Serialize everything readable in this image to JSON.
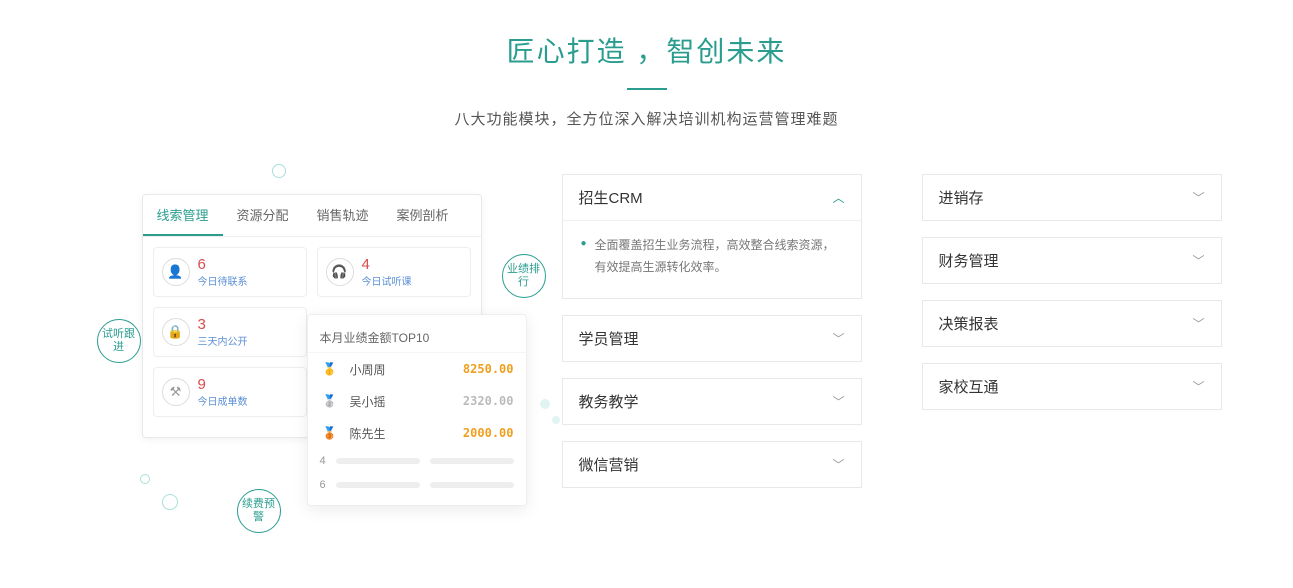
{
  "header": {
    "title": "匠心打造 ，智创未来",
    "subtitle": "八大功能模块，全方位深入解决培训机构运营管理难题"
  },
  "panel": {
    "tabs": [
      "线索管理",
      "资源分配",
      "销售轨迹",
      "案例剖析"
    ],
    "stats": [
      {
        "num": "6",
        "label": "今日待联系",
        "icon": "user"
      },
      {
        "num": "4",
        "label": "今日试听课",
        "icon": "headset"
      },
      {
        "num": "3",
        "label": "三天内公开",
        "icon": "lock"
      },
      {
        "num": "9",
        "label": "今日成单数",
        "icon": "hammer"
      }
    ]
  },
  "top10": {
    "title": "本月业绩金额TOP10",
    "rows": [
      {
        "rank": 1,
        "name": "小周周",
        "value": "8250.00"
      },
      {
        "rank": 2,
        "name": "吴小摇",
        "value": "2320.00"
      },
      {
        "rank": 3,
        "name": "陈先生",
        "value": "2000.00"
      }
    ],
    "extraRows": [
      "4",
      "6"
    ]
  },
  "bubbles": {
    "b1": "试听跟进",
    "b2": "业绩排行",
    "b3": "续费预警"
  },
  "accordion": {
    "col1": [
      {
        "label": "招生CRM",
        "open": true,
        "body": "全面覆盖招生业务流程，高效整合线索资源，有效提高生源转化效率。"
      },
      {
        "label": "学员管理",
        "open": false
      },
      {
        "label": "教务教学",
        "open": false
      },
      {
        "label": "微信营销",
        "open": false
      }
    ],
    "col2": [
      {
        "label": "进销存",
        "open": false
      },
      {
        "label": "财务管理",
        "open": false
      },
      {
        "label": "决策报表",
        "open": false
      },
      {
        "label": "家校互通",
        "open": false
      }
    ]
  }
}
